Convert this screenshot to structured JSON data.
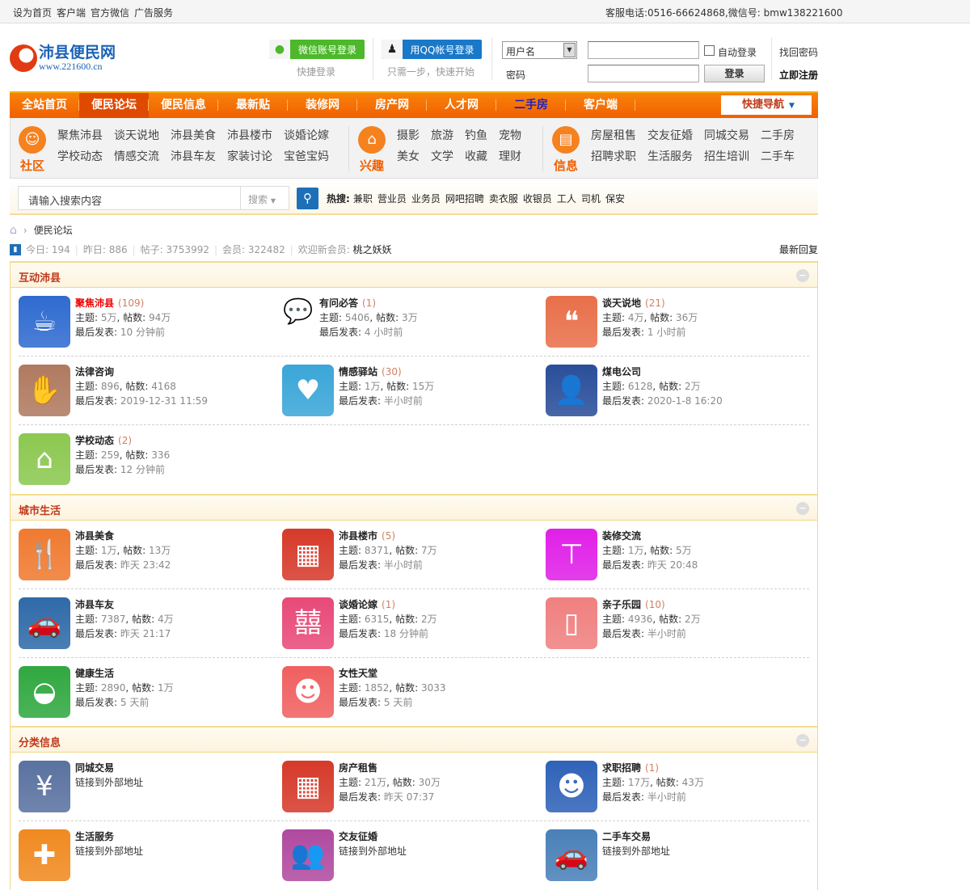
{
  "topbar": {
    "links": [
      "设为首页",
      "客户端",
      "官方微信",
      "广告服务"
    ],
    "contact": "客服电话:0516-66624868,微信号: bmw138221600"
  },
  "header": {
    "logo_title": "沛县便民网",
    "logo_url": "www.221600.cn",
    "wechat_login": "微信账号登录",
    "wechat_caption": "快捷登录",
    "qq_login": "用QQ帐号登录",
    "qq_caption": "只需一步，快速开始",
    "username_select": "用户名",
    "password_label": "密码",
    "auto_login": "自动登录",
    "login_button": "登录",
    "forgot_password": "找回密码",
    "register": "立即注册"
  },
  "nav": {
    "items": [
      {
        "label": "全站首页"
      },
      {
        "label": "便民论坛",
        "active": true
      },
      {
        "label": "便民信息"
      },
      {
        "label": "最新贴"
      },
      {
        "label": "装修网"
      },
      {
        "label": "房产网"
      },
      {
        "label": "人才网"
      },
      {
        "label": "二手房",
        "blue": true
      },
      {
        "label": "客户端"
      }
    ],
    "quick_nav": "快捷导航"
  },
  "subnav": {
    "groups": [
      {
        "label": "社区",
        "icon": "community-icon",
        "links": [
          "聚焦沛县",
          "谈天说地",
          "沛县美食",
          "沛县楼市",
          "谈婚论嫁",
          "学校动态",
          "情感交流",
          "沛县车友",
          "家装讨论",
          "宝爸宝妈"
        ],
        "cols": 5
      },
      {
        "label": "兴趣",
        "icon": "museum-icon",
        "links": [
          "摄影",
          "旅游",
          "钓鱼",
          "宠物",
          "美女",
          "文学",
          "收藏",
          "理财"
        ],
        "cols": 4
      },
      {
        "label": "信息",
        "icon": "document-icon",
        "links": [
          "房屋租售",
          "交友征婚",
          "同城交易",
          "二手房",
          "招聘求职",
          "生活服务",
          "招生培训",
          "二手车"
        ],
        "cols": 4
      }
    ]
  },
  "search": {
    "placeholder": "请输入搜索内容",
    "type": "搜索",
    "hot_label": "热搜:",
    "hot": [
      "兼职",
      "营业员",
      "业务员",
      "网吧招聘",
      "卖衣服",
      "收银员",
      "工人",
      "司机",
      "保安"
    ]
  },
  "breadcrumb": {
    "current": "便民论坛"
  },
  "stats": {
    "today_label": "今日:",
    "today": "194",
    "yesterday_label": "昨日:",
    "yesterday": "886",
    "posts_label": "帖子:",
    "posts": "3753992",
    "members_label": "会员:",
    "members": "322482",
    "welcome_label": "欢迎新会员:",
    "new_member": "桃之妖妖",
    "latest_replies": "最新回复"
  },
  "sections": [
    {
      "title": "互动沛县",
      "rows": [
        [
          {
            "name": "聚焦沛县",
            "hl": true,
            "count": "(109)",
            "icon": "teacup-icon",
            "color": "#2f6bd0",
            "l1k": "主题:",
            "l1v": "5万",
            "l1k2": "帖数:",
            "l1v2": "94万",
            "l2k": "最后发表:",
            "l2v": "10 分钟前"
          },
          {
            "name": "有问必答",
            "count": "(1)",
            "icon": "speech-bubble-icon",
            "color": "none",
            "l1k": "主题:",
            "l1v": "5406",
            "l1k2": "帖数:",
            "l1v2": "3万",
            "l2k": "最后发表:",
            "l2v": "4 小时前"
          },
          {
            "name": "谈天说地",
            "count": "(21)",
            "icon": "chat-bubbles-icon",
            "color": "#e8704a",
            "l1k": "主题:",
            "l1v": "4万",
            "l1k2": "帖数:",
            "l1v2": "36万",
            "l2k": "最后发表:",
            "l2v": "1 小时前"
          }
        ],
        [
          {
            "name": "法律咨询",
            "icon": "hands-icon",
            "color": "#b07a60",
            "l1k": "主题:",
            "l1v": "896",
            "l1k2": "帖数:",
            "l1v2": "4168",
            "l2k": "最后发表:",
            "l2v": "2019-12-31 11:59"
          },
          {
            "name": "情感驿站",
            "count": "(30)",
            "icon": "heart-icon",
            "color": "#3aa6d8",
            "l1k": "主题:",
            "l1v": "1万",
            "l1k2": "帖数:",
            "l1v2": "15万",
            "l2k": "最后发表:",
            "l2v": "半小时前"
          },
          {
            "name": "煤电公司",
            "icon": "businessman-icon",
            "color": "#2a4e9a",
            "l1k": "主题:",
            "l1v": "6128",
            "l1k2": "帖数:",
            "l1v2": "2万",
            "l2k": "最后发表:",
            "l2v": "2020-1-8 16:20"
          }
        ],
        [
          {
            "name": "学校动态",
            "count": "(2)",
            "icon": "school-icon",
            "color": "#8cc850",
            "l1k": "主题:",
            "l1v": "259",
            "l1k2": "帖数:",
            "l1v2": "336",
            "l2k": "最后发表:",
            "l2v": "12 分钟前"
          }
        ]
      ]
    },
    {
      "title": "城市生活",
      "rows": [
        [
          {
            "name": "沛县美食",
            "icon": "cutlery-icon",
            "color": "#f07a30",
            "l1k": "主题:",
            "l1v": "1万",
            "l1k2": "帖数:",
            "l1v2": "13万",
            "l2k": "最后发表:",
            "l2v": "昨天 23:42"
          },
          {
            "name": "沛县楼市",
            "count": "(5)",
            "icon": "building-icon",
            "color": "#d63a2a",
            "l1k": "主题:",
            "l1v": "8371",
            "l1k2": "帖数:",
            "l1v2": "7万",
            "l2k": "最后发表:",
            "l2v": "半小时前"
          },
          {
            "name": "装修交流",
            "icon": "paint-roller-icon",
            "color": "#e020e8",
            "l1k": "主题:",
            "l1v": "1万",
            "l1k2": "帖数:",
            "l1v2": "5万",
            "l2k": "最后发表:",
            "l2v": "昨天 20:48"
          }
        ],
        [
          {
            "name": "沛县车友",
            "icon": "car-icon",
            "color": "#2f6aa8",
            "l1k": "主题:",
            "l1v": "7387",
            "l1k2": "帖数:",
            "l1v2": "4万",
            "l2k": "最后发表:",
            "l2v": "昨天 21:17"
          },
          {
            "name": "谈婚论嫁",
            "count": "(1)",
            "icon": "double-happiness-icon",
            "color": "#e84a78",
            "l1k": "主题:",
            "l1v": "6315",
            "l1k2": "帖数:",
            "l1v2": "2万",
            "l2k": "最后发表:",
            "l2v": "18 分钟前"
          },
          {
            "name": "亲子乐园",
            "count": "(10)",
            "icon": "baby-bottle-icon",
            "color": "#f08080",
            "l1k": "主题:",
            "l1v": "4936",
            "l1k2": "帖数:",
            "l1v2": "2万",
            "l2k": "最后发表:",
            "l2v": "半小时前"
          }
        ],
        [
          {
            "name": "健康生活",
            "icon": "pot-icon",
            "color": "#30a840",
            "l1k": "主题:",
            "l1v": "2890",
            "l1k2": "帖数:",
            "l1v2": "1万",
            "l2k": "最后发表:",
            "l2v": "5 天前"
          },
          {
            "name": "女性天堂",
            "icon": "woman-profile-icon",
            "color": "#f06060",
            "l1k": "主题:",
            "l1v": "1852",
            "l1k2": "帖数:",
            "l1v2": "3033",
            "l2k": "最后发表:",
            "l2v": "5 天前"
          }
        ]
      ]
    },
    {
      "title": "分类信息",
      "rows": [
        [
          {
            "name": "同城交易",
            "icon": "money-bag-icon",
            "color": "#5a72a0",
            "link": "链接到外部地址"
          },
          {
            "name": "房产租售",
            "icon": "building-icon",
            "color": "#d63a2a",
            "l1k": "主题:",
            "l1v": "21万",
            "l1k2": "帖数:",
            "l1v2": "30万",
            "l2k": "最后发表:",
            "l2v": "昨天 07:37"
          },
          {
            "name": "求职招聘",
            "count": "(1)",
            "icon": "man-profile-icon",
            "color": "#2f62b8",
            "l1k": "主题:",
            "l1v": "17万",
            "l1k2": "帖数:",
            "l1v2": "43万",
            "l2k": "最后发表:",
            "l2v": "半小时前"
          }
        ],
        [
          {
            "name": "生活服务",
            "icon": "puzzle-icon",
            "color": "#f08a20",
            "link": "链接到外部地址"
          },
          {
            "name": "交友征婚",
            "icon": "people-icon",
            "color": "#b04aa0",
            "link": "链接到外部地址"
          },
          {
            "name": "二手车交易",
            "icon": "car-icon",
            "color": "#4a80b8",
            "link": "链接到外部地址"
          }
        ]
      ]
    }
  ]
}
